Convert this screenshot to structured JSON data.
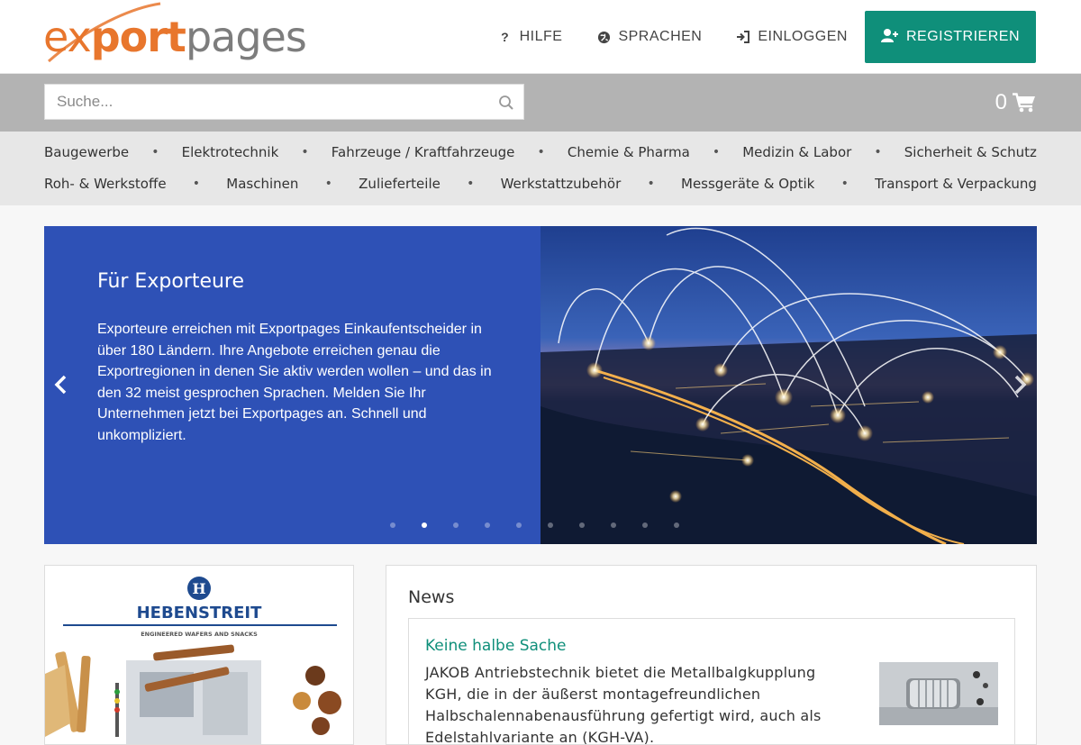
{
  "header": {
    "logo": {
      "part1": "ex",
      "part2": "port",
      "part3": "pages"
    },
    "nav": {
      "help_label": "HILFE",
      "languages_label": "SPRACHEN",
      "login_label": "EINLOGGEN",
      "register_label": "REGISTRIEREN"
    }
  },
  "search": {
    "placeholder": "Suche...",
    "value": ""
  },
  "cart": {
    "count": "0"
  },
  "categories": {
    "row1": [
      "Baugewerbe",
      "Elektrotechnik",
      "Fahrzeuge / Kraftfahrzeuge",
      "Chemie & Pharma",
      "Medizin & Labor",
      "Sicherheit & Schutz"
    ],
    "row2": [
      "Roh- & Werkstoffe",
      "Maschinen",
      "Zulieferteile",
      "Werkstattzubehör",
      "Messgeräte & Optik",
      "Transport & Verpackung"
    ],
    "separator": "•"
  },
  "hero": {
    "title": "Für Exporteure",
    "text": "Exporteure erreichen mit Exportpages Einkaufentscheider in über 180 Ländern. Ihre Angebote erreichen genau die Exportregionen in denen Sie aktiv werden wollen – und das in den 32 meist gesprochen Sprachen. Melden Sie Ihr Unternehmen jetzt bei Exportpages an. Schnell und unkompliziert.",
    "slide_count": 10,
    "active_slide": 1
  },
  "ad": {
    "brand": "HEBENSTREIT",
    "tagline": "ENGINEERED WAFERS AND SNACKS",
    "emblem": "H"
  },
  "news": {
    "heading": "News",
    "items": [
      {
        "title": "Keine halbe Sache",
        "text": "JAKOB Antriebstechnik bietet die Metallbalgkupplung KGH, die in der äußerst montagefreundlichen Halbschalennabenausführung gefertigt wird, auch als Edelstahlvariante an (KGH-VA)."
      }
    ]
  },
  "colors": {
    "brand_orange": "#e8762d",
    "accent_teal": "#0f8f7a",
    "hero_blue": "#2e51b6",
    "search_bar_gray": "#b3b3b3",
    "category_bar_gray": "#e7e7e7"
  }
}
